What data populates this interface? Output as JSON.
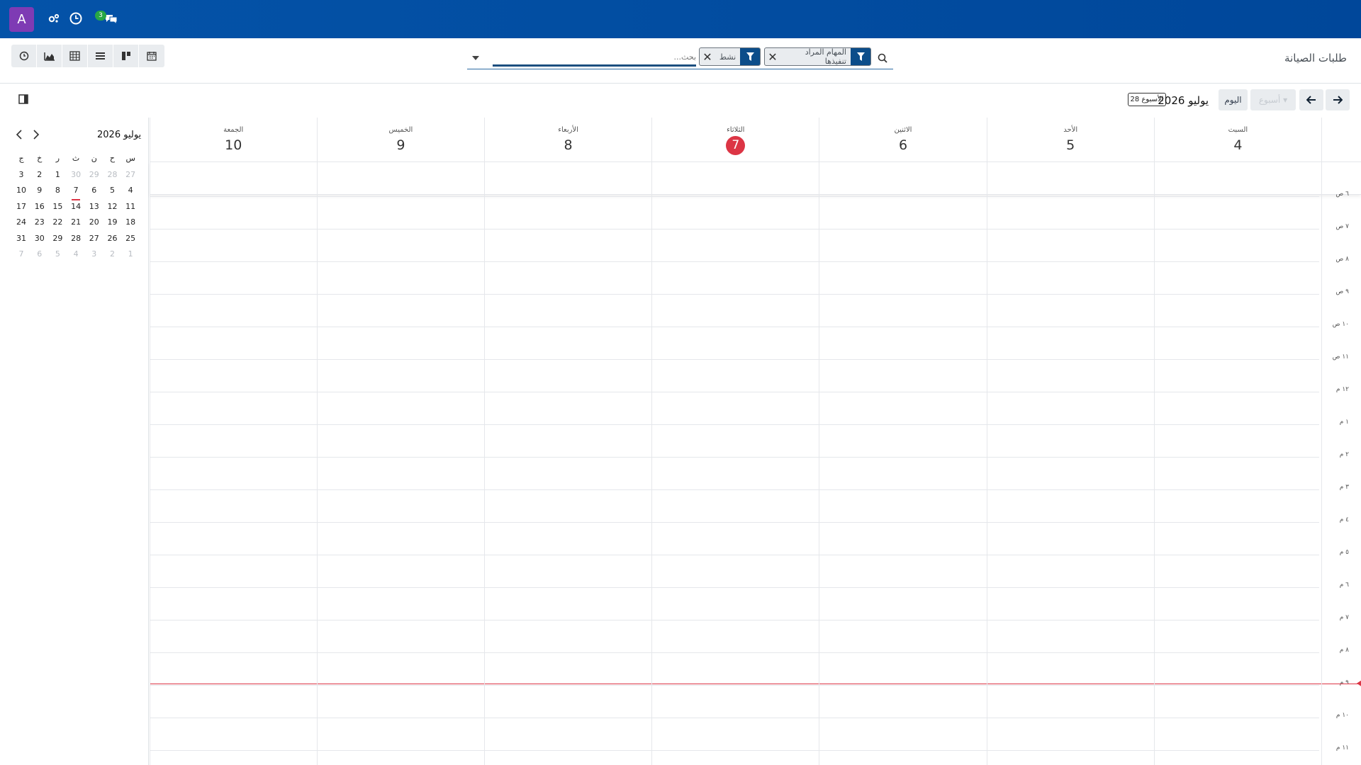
{
  "navbar": {
    "avatar_letter": "A",
    "icons": [
      "settings-gears-icon",
      "clock-icon",
      "chat-icon"
    ],
    "messages_badge": "3"
  },
  "control_panel": {
    "breadcrumb": "طلبات الصيانة",
    "views": [
      "activity-view-icon",
      "graph-view-icon",
      "pivot-view-icon",
      "list-view-icon",
      "kanban-view-icon",
      "calendar-view-icon"
    ]
  },
  "search": {
    "placeholder": "بحث...",
    "facets": [
      {
        "label": "نشط"
      },
      {
        "label": "المهام المراد تنفيذها"
      }
    ]
  },
  "date_toolbar": {
    "today_label": "اليوم",
    "scale_label": "أسبوع",
    "range_label": "يوليو 2026",
    "week_badge": "الأسبوع 28"
  },
  "mini_calendar": {
    "title": "يوليو 2026",
    "weekdays": [
      "س",
      "ح",
      "ن",
      "ث",
      "ر",
      "خ",
      "ج"
    ],
    "weeks": [
      [
        {
          "d": "27",
          "m": true
        },
        {
          "d": "28",
          "m": true
        },
        {
          "d": "29",
          "m": true
        },
        {
          "d": "30",
          "m": true
        },
        {
          "d": "1"
        },
        {
          "d": "2"
        },
        {
          "d": "3"
        }
      ],
      [
        {
          "d": "4"
        },
        {
          "d": "5"
        },
        {
          "d": "6"
        },
        {
          "d": "7",
          "sel": true
        },
        {
          "d": "8"
        },
        {
          "d": "9"
        },
        {
          "d": "10"
        }
      ],
      [
        {
          "d": "11"
        },
        {
          "d": "12"
        },
        {
          "d": "13"
        },
        {
          "d": "14"
        },
        {
          "d": "15"
        },
        {
          "d": "16"
        },
        {
          "d": "17"
        }
      ],
      [
        {
          "d": "18"
        },
        {
          "d": "19"
        },
        {
          "d": "20"
        },
        {
          "d": "21"
        },
        {
          "d": "22"
        },
        {
          "d": "23"
        },
        {
          "d": "24"
        }
      ],
      [
        {
          "d": "25"
        },
        {
          "d": "26"
        },
        {
          "d": "27"
        },
        {
          "d": "28"
        },
        {
          "d": "29"
        },
        {
          "d": "30"
        },
        {
          "d": "31"
        }
      ],
      [
        {
          "d": "1",
          "m": true
        },
        {
          "d": "2",
          "m": true
        },
        {
          "d": "3",
          "m": true
        },
        {
          "d": "4",
          "m": true
        },
        {
          "d": "5",
          "m": true
        },
        {
          "d": "6",
          "m": true
        },
        {
          "d": "7",
          "m": true
        }
      ]
    ]
  },
  "calendar": {
    "days": [
      {
        "name": "السبت",
        "num": "4"
      },
      {
        "name": "الأحد",
        "num": "5"
      },
      {
        "name": "الاثنين",
        "num": "6"
      },
      {
        "name": "الثلاثاء",
        "num": "7",
        "today": true
      },
      {
        "name": "الأربعاء",
        "num": "8"
      },
      {
        "name": "الخميس",
        "num": "9"
      },
      {
        "name": "الجمعة",
        "num": "10"
      }
    ],
    "hours": [
      "٦ ص",
      "٧ ص",
      "٨ ص",
      "٩ ص",
      "١٠ ص",
      "١١ ص",
      "١٢ م",
      "١ م",
      "٢ م",
      "٣ م",
      "٤ م",
      "٥ م",
      "٦ م",
      "٧ م",
      "٨ م",
      "٩ م",
      "١٠ م",
      "١١ م"
    ],
    "now_hour": 20.95
  },
  "colors": {
    "navbar": "#0453a8",
    "avatar": "#7e3bb4",
    "today": "#dc3545",
    "badge": "#28a745",
    "facet_icon_bg": "#0b4d8a"
  }
}
